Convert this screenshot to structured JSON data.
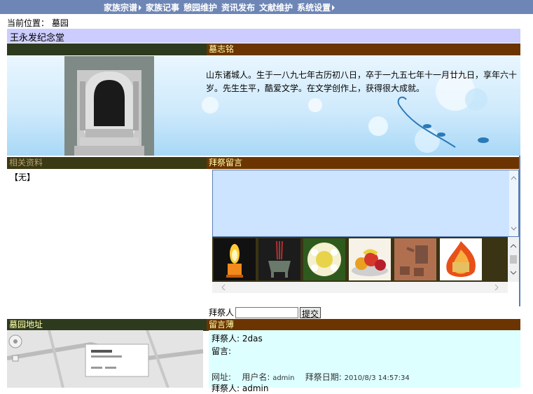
{
  "nav": {
    "items": [
      {
        "label": "家族宗谱",
        "has_arrow": true
      },
      {
        "label": "家族记事",
        "has_arrow": false
      },
      {
        "label": "憩园维护",
        "has_arrow": false
      },
      {
        "label": "资讯发布",
        "has_arrow": false
      },
      {
        "label": "文献维护",
        "has_arrow": false
      },
      {
        "label": "系统设置",
        "has_arrow": true
      }
    ]
  },
  "breadcrumb": "当前位置： 墓园",
  "memorial_title": "王永发纪念堂",
  "epitaph": {
    "header": "墓志铭",
    "text": "山东诸城人。生于一八九七年古历初八日，卒于一九五七年十一月廿九日，享年六十岁。先生生平，酷爱文学。在文学创作上，获得很大成就。"
  },
  "related": {
    "header": "相关资料",
    "content": "【无】"
  },
  "worship": {
    "header": "拜祭留言",
    "offerings": [
      "candle-icon",
      "incense-burner-icon",
      "flower-wreath-icon",
      "fruit-plate-icon",
      "wine-teapot-icon",
      "burning-paper-icon"
    ],
    "label": "拜祭人",
    "submit": "提交"
  },
  "cemetery_address": {
    "header": "墓园地址"
  },
  "guestbook": {
    "header": "留言薄",
    "entries": [
      {
        "worshipper_label": "拜祭人:",
        "worshipper": "2das",
        "message_label": "留言:",
        "url_label": "网址:",
        "username_label": "用户名:",
        "username": "admin",
        "date_label": "拜祭日期:",
        "date": "2010/8/3 14:57:34"
      },
      {
        "worshipper_label": "拜祭人:",
        "worshipper": "admin"
      }
    ]
  },
  "colors": {
    "nav_bg": "#6e86b6",
    "title_bg": "#ccccff",
    "header_brown": "#6b3400",
    "header_dark": "#2e3a1e",
    "guestbook_bg": "#ddffff"
  }
}
